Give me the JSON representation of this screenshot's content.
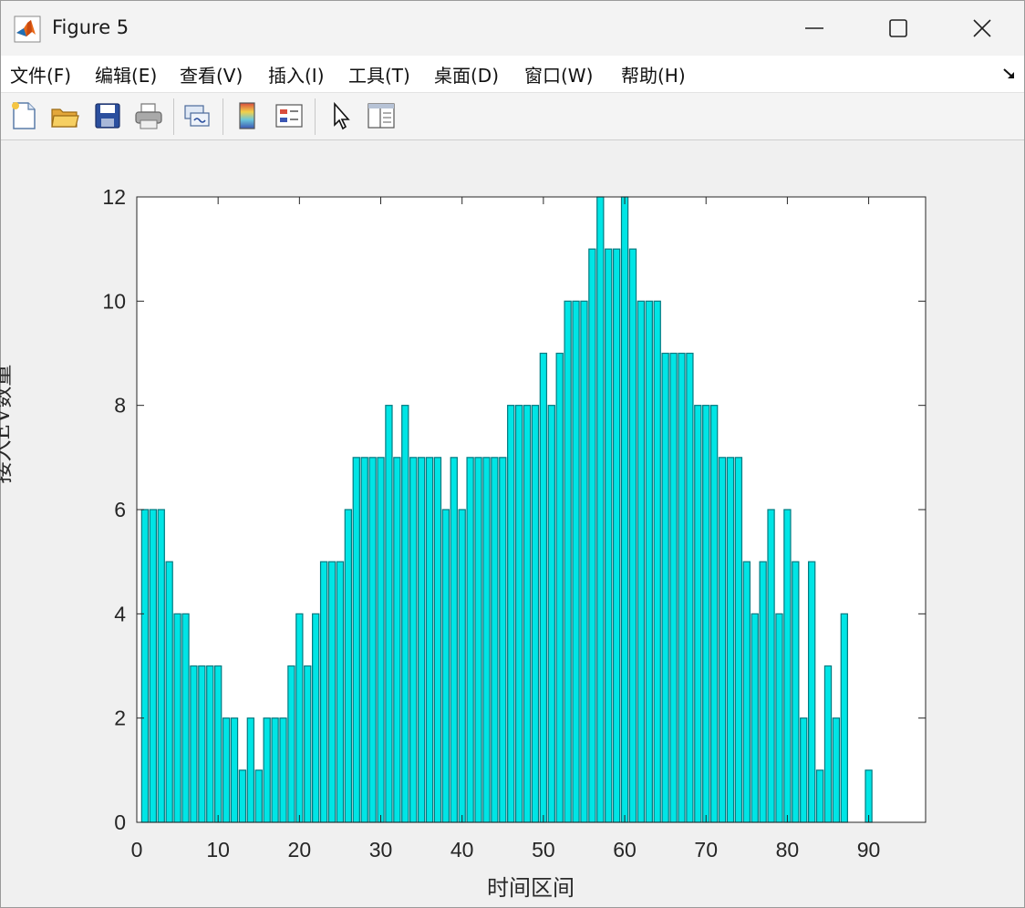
{
  "window": {
    "title": "Figure 5"
  },
  "menu": {
    "items": [
      "文件(F)",
      "编辑(E)",
      "查看(V)",
      "插入(I)",
      "工具(T)",
      "桌面(D)",
      "窗口(W)",
      "帮助(H)"
    ]
  },
  "toolbar": {
    "icons": [
      "new-figure-icon",
      "open-file-icon",
      "save-icon",
      "print-icon",
      "link-plot-icon",
      "colorbar-icon",
      "legend-icon",
      "pointer-icon",
      "property-inspector-icon"
    ]
  },
  "colors": {
    "bar_fill": "#00e5e5",
    "bar_edge": "#007a80",
    "axes_bg": "#ffffff",
    "figure_bg": "#f0f0f0"
  },
  "chart_data": {
    "type": "bar",
    "xlabel": "时间区间",
    "ylabel": "接入EV数量",
    "xlim": [
      0,
      97
    ],
    "ylim": [
      0,
      12
    ],
    "xticks": [
      0,
      10,
      20,
      30,
      40,
      50,
      60,
      70,
      80,
      90
    ],
    "yticks": [
      0,
      2,
      4,
      6,
      8,
      10,
      12
    ],
    "grid": false,
    "x": [
      1,
      2,
      3,
      4,
      5,
      6,
      7,
      8,
      9,
      10,
      11,
      12,
      13,
      14,
      15,
      16,
      17,
      18,
      19,
      20,
      21,
      22,
      23,
      24,
      25,
      26,
      27,
      28,
      29,
      30,
      31,
      32,
      33,
      34,
      35,
      36,
      37,
      38,
      39,
      40,
      41,
      42,
      43,
      44,
      45,
      46,
      47,
      48,
      49,
      50,
      51,
      52,
      53,
      54,
      55,
      56,
      57,
      58,
      59,
      60,
      61,
      62,
      63,
      64,
      65,
      66,
      67,
      68,
      69,
      70,
      71,
      72,
      73,
      74,
      75,
      76,
      77,
      78,
      79,
      80,
      81,
      82,
      83,
      84,
      85,
      86,
      87,
      88,
      89,
      90,
      91,
      92,
      93,
      94,
      95,
      96
    ],
    "values": [
      6,
      6,
      6,
      5,
      4,
      4,
      3,
      3,
      3,
      3,
      2,
      2,
      1,
      2,
      1,
      2,
      2,
      2,
      3,
      4,
      3,
      4,
      5,
      5,
      5,
      6,
      7,
      7,
      7,
      7,
      8,
      7,
      8,
      7,
      7,
      7,
      7,
      6,
      7,
      6,
      7,
      7,
      7,
      7,
      7,
      8,
      8,
      8,
      8,
      9,
      8,
      9,
      10,
      10,
      10,
      11,
      12,
      11,
      11,
      12,
      11,
      10,
      10,
      10,
      9,
      9,
      9,
      9,
      8,
      8,
      8,
      7,
      7,
      7,
      5,
      4,
      5,
      6,
      4,
      6,
      5,
      2,
      5,
      1,
      3,
      2,
      4,
      0,
      0,
      1,
      0,
      0,
      0,
      0,
      0,
      0
    ]
  }
}
